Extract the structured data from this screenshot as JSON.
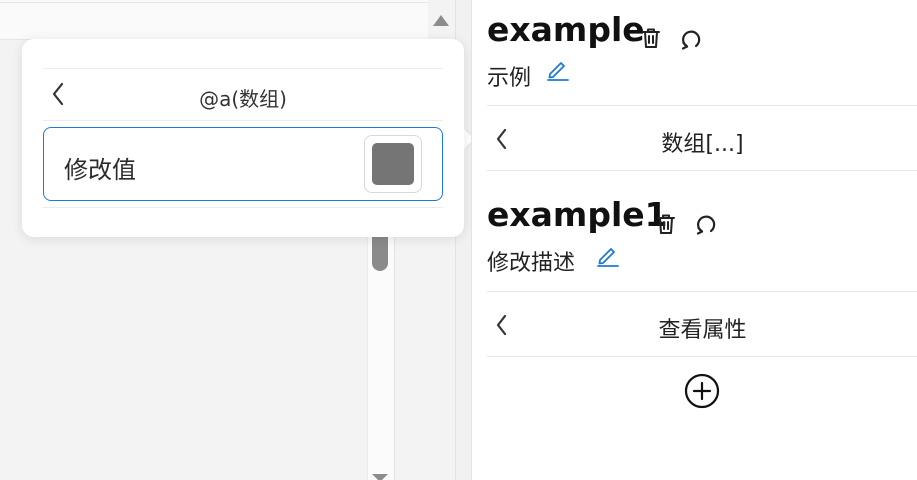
{
  "popover": {
    "title": "@a(数组)",
    "field_label": "修改值",
    "swatch_color": "#757575"
  },
  "nodes": [
    {
      "title": "example",
      "description": "示例"
    },
    {
      "title": "example1",
      "description": "修改描述"
    }
  ],
  "rows": [
    {
      "label": "数组[...]"
    },
    {
      "label": "查看属性"
    }
  ],
  "icons": {
    "back": "chevron-left-icon",
    "delete": "trash-icon",
    "reset": "refresh-icon",
    "edit": "pencil-icon",
    "add": "plus-circle-icon"
  },
  "colors": {
    "accent": "#1e7ad6"
  }
}
